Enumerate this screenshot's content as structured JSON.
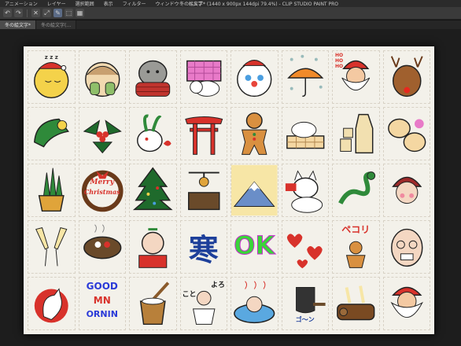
{
  "menubar": {
    "items": [
      "アニメーション",
      "レイヤー",
      "選択範囲",
      "表示",
      "フィルター",
      "ウィンドウ",
      "ヘルプ"
    ],
    "window_title": "冬の絵文字* (1440 x 900px 144dpi 79.4%) - CLIP STUDIO PAINT PRO"
  },
  "toolbar": {
    "icons": [
      "undo-icon",
      "redo-icon",
      "clear-icon",
      "transform-icon",
      "pen-icon",
      "selection-icon",
      "grid-icon"
    ],
    "glyphs": [
      "↶",
      "↷",
      "✕",
      "⤢",
      "✎",
      "⬚",
      "▦"
    ]
  },
  "tabs": [
    {
      "label": "冬の絵文字*",
      "active": true
    },
    {
      "label": "冬の絵文字(…",
      "active": false
    }
  ],
  "stickers": {
    "merry_christmas": {
      "line1": "Merry",
      "line2": "Christmas"
    },
    "ok": "OK",
    "kanji_cold": "寒",
    "hohoho": "HO HO HO",
    "pekori": "ペコリ",
    "good_morning": {
      "line1": "GOOD",
      "line2": "MN",
      "line3": "ORNIN"
    },
    "kotoyoro": {
      "left": "こと",
      "right": "よろ"
    },
    "gon": "ゴ〜ン",
    "zzz": "z z z"
  },
  "colors": {
    "accent_blue": "#5b6b86",
    "canvas": "#f3f1ea",
    "red": "#d8322b",
    "green": "#2f8a3a"
  }
}
